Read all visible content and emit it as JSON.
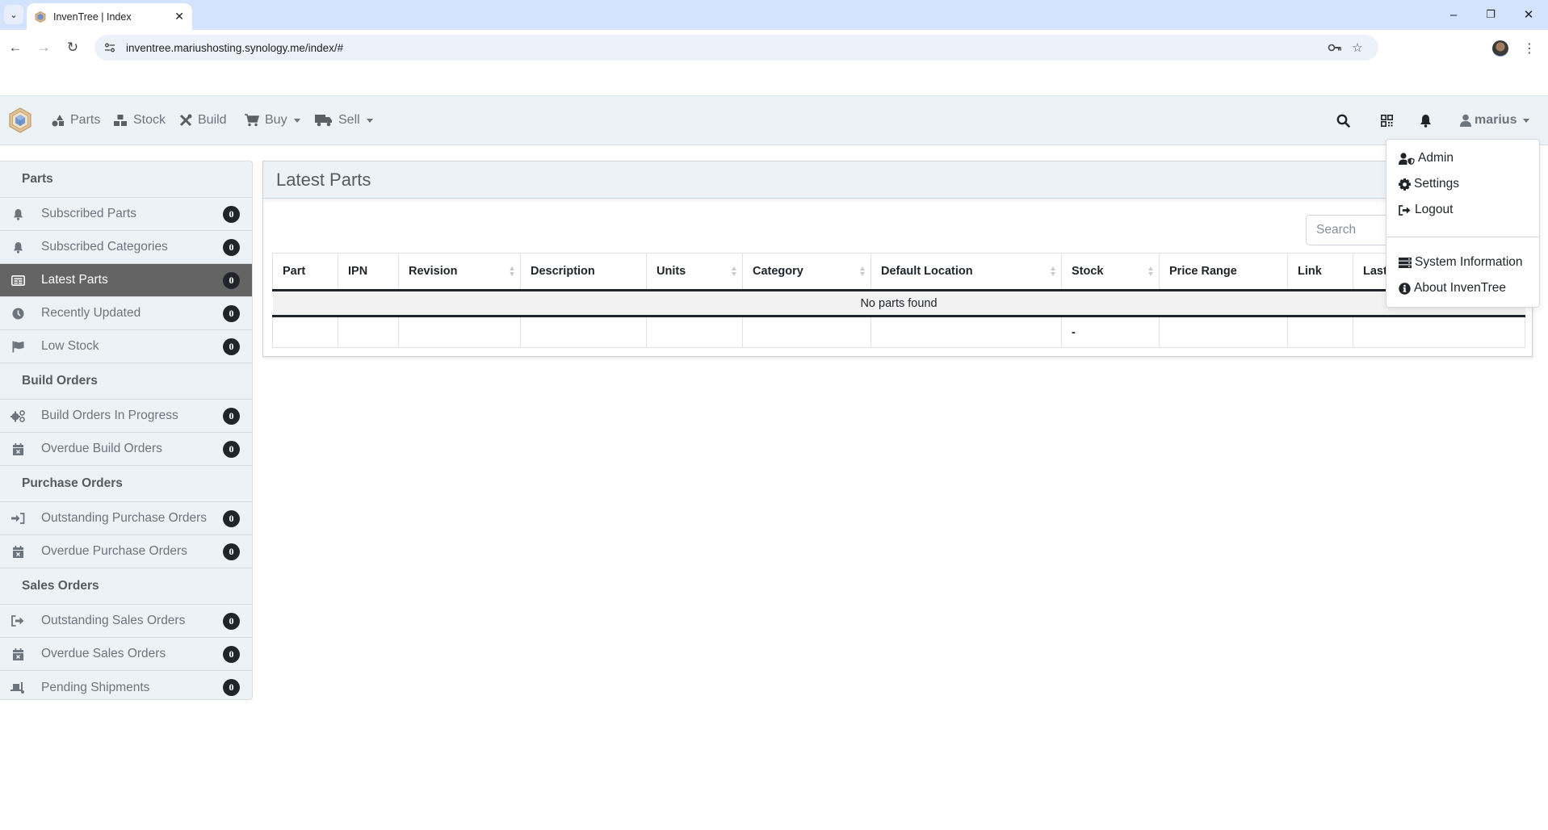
{
  "browser": {
    "tab_title": "InvenTree | Index",
    "url": "inventree.mariushosting.synology.me/index/#",
    "icons": {
      "tab_list": "chevron-down-icon",
      "tab_close": "close-icon",
      "back": "back-arrow-icon",
      "forward": "forward-arrow-icon",
      "reload": "reload-icon",
      "site_info": "site-settings-icon",
      "password": "key-icon",
      "bookmark": "star-icon",
      "profile": "profile-avatar",
      "menu": "vertical-dots-icon",
      "minimize": "minimize-icon",
      "restore": "restore-icon",
      "close": "close-window-icon"
    }
  },
  "navbar": {
    "items": [
      {
        "label": "Parts",
        "icon": "shapes-icon",
        "dropdown": false
      },
      {
        "label": "Stock",
        "icon": "boxes-icon",
        "dropdown": false
      },
      {
        "label": "Build",
        "icon": "tools-icon",
        "dropdown": false
      },
      {
        "label": "Buy",
        "icon": "cart-icon",
        "dropdown": true
      },
      {
        "label": "Sell",
        "icon": "truck-icon",
        "dropdown": true
      }
    ],
    "right_icons": [
      "search-icon",
      "qrcode-icon",
      "bell-icon"
    ],
    "user": "marius"
  },
  "user_menu": {
    "items": [
      {
        "label": "Admin",
        "icon": "user-shield-icon"
      },
      {
        "label": "Settings",
        "icon": "cog-icon"
      },
      {
        "label": "Logout",
        "icon": "sign-out-icon"
      },
      {
        "label": "System Information",
        "icon": "server-icon"
      },
      {
        "label": "About InvenTree",
        "icon": "info-circle-icon"
      }
    ]
  },
  "sidebar": {
    "sections": [
      {
        "title": "Parts",
        "items": [
          {
            "label": "Subscribed Parts",
            "icon": "bell-icon",
            "count": "0"
          },
          {
            "label": "Subscribed Categories",
            "icon": "bell-icon",
            "count": "0"
          },
          {
            "label": "Latest Parts",
            "icon": "newspaper-icon",
            "count": "0",
            "active": true
          },
          {
            "label": "Recently Updated",
            "icon": "clock-icon",
            "count": "0"
          },
          {
            "label": "Low Stock",
            "icon": "flag-icon",
            "count": "0"
          }
        ]
      },
      {
        "title": "Build Orders",
        "items": [
          {
            "label": "Build Orders In Progress",
            "icon": "cogs-icon",
            "count": "0"
          },
          {
            "label": "Overdue Build Orders",
            "icon": "calendar-times-icon",
            "count": "0"
          }
        ]
      },
      {
        "title": "Purchase Orders",
        "items": [
          {
            "label": "Outstanding Purchase Orders",
            "icon": "sign-in-icon",
            "count": "0"
          },
          {
            "label": "Overdue Purchase Orders",
            "icon": "calendar-times-icon",
            "count": "0"
          }
        ]
      },
      {
        "title": "Sales Orders",
        "items": [
          {
            "label": "Outstanding Sales Orders",
            "icon": "sign-out-icon",
            "count": "0"
          },
          {
            "label": "Overdue Sales Orders",
            "icon": "calendar-times-icon",
            "count": "0"
          },
          {
            "label": "Pending Shipments",
            "icon": "dolly-icon",
            "count": "0"
          }
        ]
      }
    ]
  },
  "main": {
    "title": "Latest Parts",
    "search_placeholder": "Search",
    "table": {
      "columns": [
        {
          "label": "Part",
          "sortable": false
        },
        {
          "label": "IPN",
          "sortable": false
        },
        {
          "label": "Revision",
          "sortable": true
        },
        {
          "label": "Description",
          "sortable": false
        },
        {
          "label": "Units",
          "sortable": true
        },
        {
          "label": "Category",
          "sortable": true
        },
        {
          "label": "Default Location",
          "sortable": true
        },
        {
          "label": "Stock",
          "sortable": true
        },
        {
          "label": "Price Range",
          "sortable": false
        },
        {
          "label": "Link",
          "sortable": false
        },
        {
          "label": "Last",
          "sortable": false
        }
      ],
      "empty_message": "No parts found",
      "footer": [
        "",
        "",
        "",
        "",
        "",
        "",
        "",
        "-",
        "",
        "",
        ""
      ]
    }
  }
}
